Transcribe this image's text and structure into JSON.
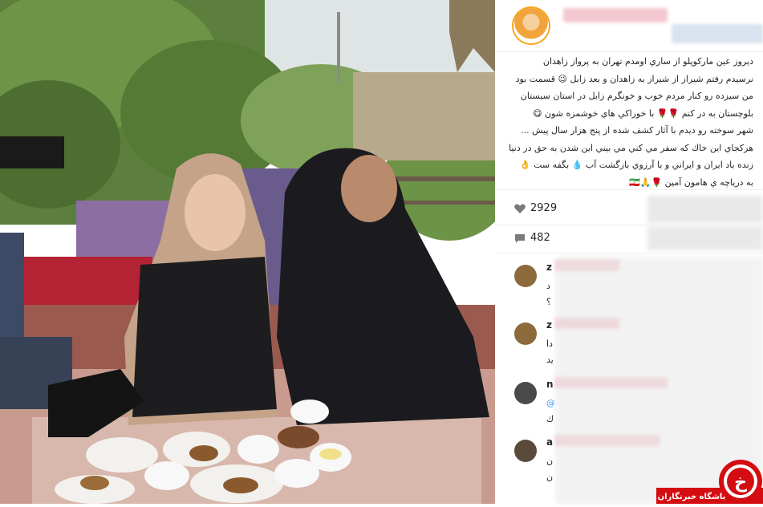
{
  "post": {
    "caption_lines": [
      "ديروز عين ماركوپلو از ساري اومدم تهران به پرواز زاهدان",
      "نرسيدم رفتم شيراز از شيراز به زاهدان و بعد زابل 😉 قسمت بود",
      "من سيزده رو كنار مردم خوب و خونگرم زابل در استان سيستان",
      "بلوچستان به در كنم 🌹🌹 با خوراكي هاي خوشمزه شون 😋",
      "شهر سوخته رو ديدم با آثار كشف شده از پنج هزار سال پيش ...",
      "هركجاي اين خاك كه سفر مي كني مي بيني اين شدن به حق در دنيا",
      "زنده باد ايران و ايراني و با آرزوي بازگشت آب 💧 بگفه ست 👌",
      "به درياچه ي هامون آمين 🌹🙏🇮🇷"
    ],
    "likes_count": "2929",
    "comments_count": "482"
  },
  "comments": [
    {
      "username_initial": "z",
      "text_lines": [
        "د",
        "؟"
      ]
    },
    {
      "username_initial": "z",
      "text_lines": [
        "دا",
        "يد"
      ]
    },
    {
      "username_initial": "n",
      "text_lines": [
        "@",
        "ك"
      ]
    },
    {
      "username_initial": "a",
      "text_lines": [
        "ن",
        "ن"
      ]
    }
  ],
  "watermark": {
    "label": "باشگاه خبرنگاران",
    "glyph": "خ"
  },
  "colors": {
    "accent_ring": "#f7a51b",
    "watermark_red": "#d40d12",
    "text": "#262626"
  }
}
